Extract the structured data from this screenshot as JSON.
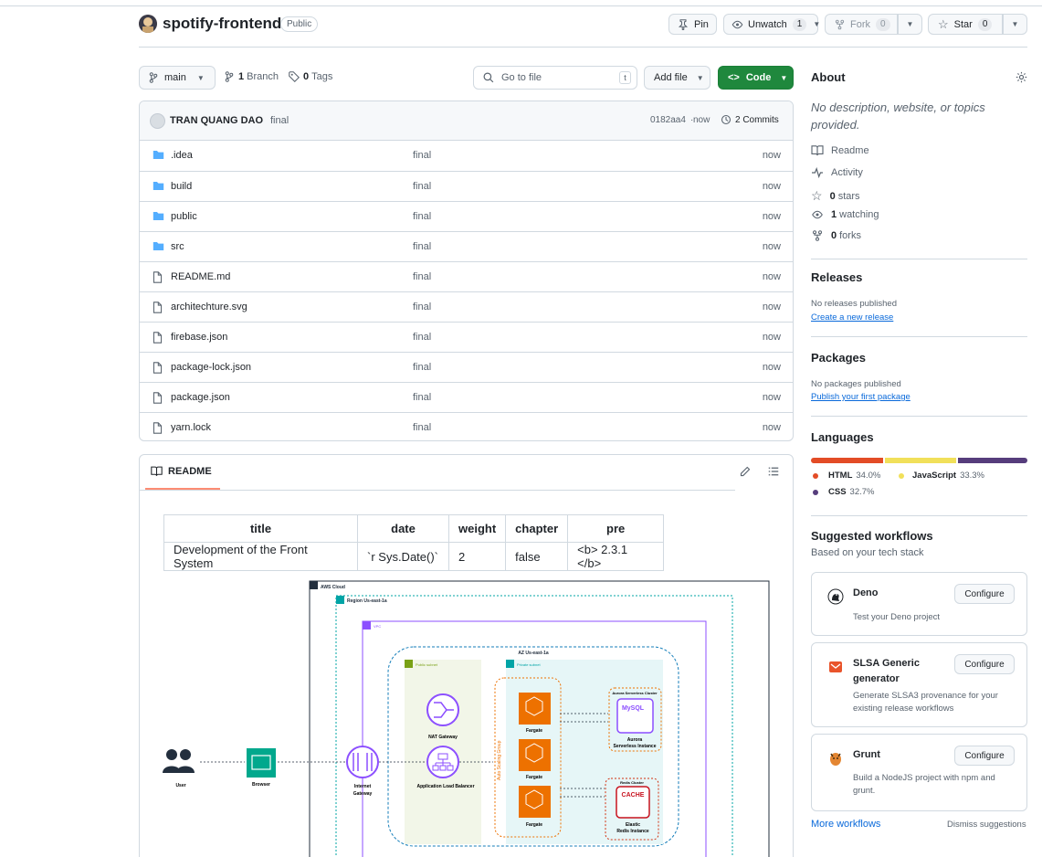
{
  "repo": {
    "name": "spotify-frontend",
    "visibility": "Public"
  },
  "actions": {
    "pin": "Pin",
    "unwatch": "Unwatch",
    "watch_count": "1",
    "fork": "Fork",
    "fork_count": "0",
    "star": "Star",
    "star_count": "0"
  },
  "toolbar": {
    "branch": "main",
    "branch_count": "1",
    "branch_label": "Branch",
    "tag_count": "0",
    "tag_label": "Tags",
    "search_placeholder": "Go to file",
    "search_key": "t",
    "add_file": "Add file",
    "code": "Code"
  },
  "commit": {
    "author": "TRAN QUANG DAO",
    "message": "final",
    "hash": "0182aa4",
    "sep": "·",
    "time": "now",
    "commits": "2 Commits"
  },
  "files": [
    {
      "name": ".idea",
      "type": "dir",
      "message": "final",
      "time": "now"
    },
    {
      "name": "build",
      "type": "dir",
      "message": "final",
      "time": "now"
    },
    {
      "name": "public",
      "type": "dir",
      "message": "final",
      "time": "now"
    },
    {
      "name": "src",
      "type": "dir",
      "message": "final",
      "time": "now"
    },
    {
      "name": "README.md",
      "type": "file",
      "message": "final",
      "time": "now"
    },
    {
      "name": "architechture.svg",
      "type": "file",
      "message": "final",
      "time": "now"
    },
    {
      "name": "firebase.json",
      "type": "file",
      "message": "final",
      "time": "now"
    },
    {
      "name": "package-lock.json",
      "type": "file",
      "message": "final",
      "time": "now"
    },
    {
      "name": "package.json",
      "type": "file",
      "message": "final",
      "time": "now"
    },
    {
      "name": "yarn.lock",
      "type": "file",
      "message": "final",
      "time": "now"
    }
  ],
  "readme": {
    "tab": "README",
    "table": {
      "headers": [
        "title",
        "date",
        "weight",
        "chapter",
        "pre"
      ],
      "row": [
        "Development of the Front System",
        "`r Sys.Date()`",
        "2",
        "false",
        "<b> 2.3.1 </b>"
      ]
    },
    "diagram": {
      "cloud": "AWS Cloud",
      "region": "Region Us-east-1a",
      "vpc": "VPC",
      "az": "AZ Us-east-1a",
      "public_subnet": "Public subnet",
      "private_subnet": "Private subnet",
      "asg": "Auto Scaling Group",
      "user": "User",
      "browser": "Browser",
      "igw": [
        "Internet",
        "Gateway"
      ],
      "nat": "NAT Gateway",
      "alb": "Application Load Balancer",
      "fargate": "Fargate",
      "aurora_cluster": "Aurora Serverless Cluster",
      "mysql": "MySQL",
      "aurora": [
        "Aurora",
        "Serverless Instance"
      ],
      "redis_cluster": "Redis Cluster",
      "cache": "CACHE",
      "redis": [
        "Elastic",
        "Redis Instance"
      ]
    }
  },
  "about": {
    "title": "About",
    "description": "No description, website, or topics provided.",
    "readme": "Readme",
    "activity": "Activity",
    "stars_n": "0",
    "stars": "stars",
    "watching_n": "1",
    "watching": "watching",
    "forks_n": "0",
    "forks": "forks"
  },
  "releases": {
    "title": "Releases",
    "none": "No releases published",
    "create": "Create a new release"
  },
  "packages": {
    "title": "Packages",
    "none": "No packages published",
    "publish": "Publish your first package"
  },
  "languages": {
    "title": "Languages",
    "items": [
      {
        "name": "HTML",
        "pct": "34.0%",
        "value": 34.0,
        "color": "#e34c26"
      },
      {
        "name": "JavaScript",
        "pct": "33.3%",
        "value": 33.3,
        "color": "#f1e05a"
      },
      {
        "name": "CSS",
        "pct": "32.7%",
        "value": 32.7,
        "color": "#563d7c"
      }
    ]
  },
  "workflows": {
    "title": "Suggested workflows",
    "subtitle": "Based on your tech stack",
    "configure": "Configure",
    "items": [
      {
        "name": "Deno",
        "desc": "Test your Deno project"
      },
      {
        "name": "SLSA Generic generator",
        "desc": "Generate SLSA3 provenance for your existing release workflows"
      },
      {
        "name": "Grunt",
        "desc": "Build a NodeJS project with npm and grunt."
      }
    ],
    "more": "More workflows",
    "dismiss": "Dismiss suggestions"
  },
  "colors": {
    "accent": "#0969da",
    "code_button": "#1f883d",
    "readme_underline": "#fd8c73"
  }
}
